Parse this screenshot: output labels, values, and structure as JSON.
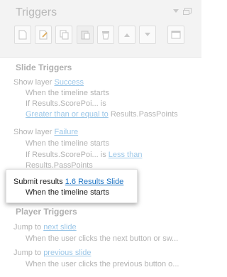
{
  "panel": {
    "title": "Triggers"
  },
  "toolbar": {
    "buttons": [
      {
        "name": "new-trigger",
        "icon": "new-page-icon"
      },
      {
        "name": "edit-trigger",
        "icon": "edit-icon"
      },
      {
        "name": "copy-trigger",
        "icon": "copy-icon"
      },
      {
        "name": "paste-trigger",
        "icon": "paste-icon"
      },
      {
        "name": "delete-trigger",
        "icon": "trash-icon"
      },
      {
        "name": "move-up",
        "icon": "arrow-up-icon"
      },
      {
        "name": "move-down",
        "icon": "arrow-down-icon"
      },
      {
        "name": "trigger-window",
        "icon": "window-icon"
      }
    ]
  },
  "slide_triggers": {
    "title": "Slide Triggers",
    "t1": {
      "action": "Show layer ",
      "target": "Success",
      "when": "When the timeline starts",
      "cond_prefix": "If Results.ScorePoi... is",
      "cond_op": "Greater than or equal to",
      "cond_value": " Results.PassPoints"
    },
    "t2": {
      "action": "Show layer ",
      "target": "Failure",
      "when": "When the timeline starts",
      "cond_prefix": "If Results.ScorePoi... is ",
      "cond_op": "Less than",
      "cond_value": "Results.PassPoints"
    },
    "t3": {
      "action": "Submit results ",
      "target": "1.6 Results Slide",
      "when": "When the timeline starts"
    }
  },
  "player_triggers": {
    "title": "Player Triggers",
    "t1": {
      "action": "Jump to ",
      "target": "next slide",
      "when": "When the user clicks the next button or sw..."
    },
    "t2": {
      "action": "Jump to ",
      "target": "previous slide",
      "when": "When the user clicks the previous button o..."
    }
  }
}
